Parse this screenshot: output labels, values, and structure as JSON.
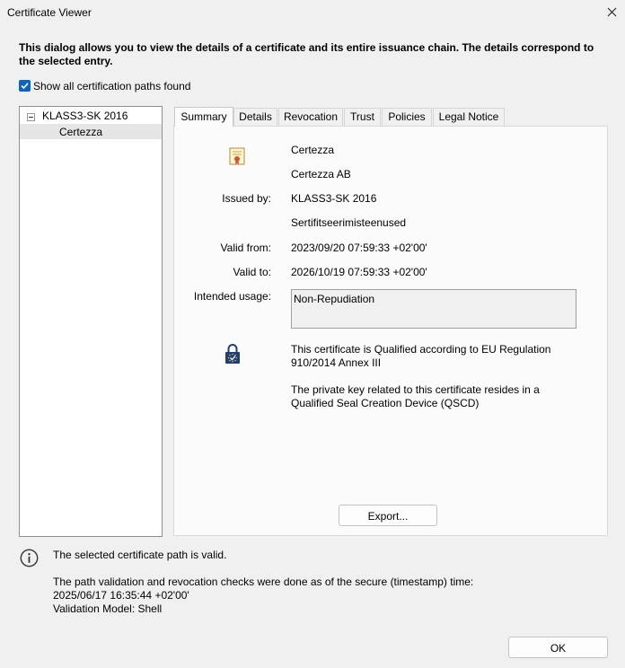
{
  "window": {
    "title": "Certificate Viewer",
    "close_icon": "close-icon"
  },
  "intro": "This dialog allows you to view the details of a certificate and its entire issuance chain. The details correspond to the selected entry.",
  "show_all_paths": {
    "label": "Show all certification paths found",
    "checked": true
  },
  "tree": {
    "root": "KLASS3-SK 2016",
    "child": "Certezza"
  },
  "tabs": [
    {
      "label": "Summary",
      "active": true
    },
    {
      "label": "Details"
    },
    {
      "label": "Revocation"
    },
    {
      "label": "Trust"
    },
    {
      "label": "Policies"
    },
    {
      "label": "Legal Notice"
    }
  ],
  "summary": {
    "subject_name": "Certezza",
    "subject_org": "Certezza AB",
    "issued_by_label": "Issued by:",
    "issuer_name": "KLASS3-SK 2016",
    "issuer_org": "Sertifitseerimisteenused",
    "valid_from_label": "Valid from:",
    "valid_from": "2023/09/20 07:59:33 +02'00'",
    "valid_to_label": "Valid to:",
    "valid_to": "2026/10/19 07:59:33 +02'00'",
    "usage_label": "Intended usage:",
    "usage": "Non-Repudiation",
    "eu_qualified": "This certificate is Qualified according to EU Regulation 910/2014 Annex III",
    "qscd": "The private key related to this certificate resides in a Qualified Seal Creation Device (QSCD)",
    "export_label": "Export..."
  },
  "status": {
    "line1": "The selected certificate path is valid.",
    "line2": "The path validation and revocation checks were done as of the secure (timestamp) time:",
    "line3": "2025/06/17 16:35:44 +02'00'",
    "line4": "Validation Model: Shell"
  },
  "ok_label": "OK"
}
